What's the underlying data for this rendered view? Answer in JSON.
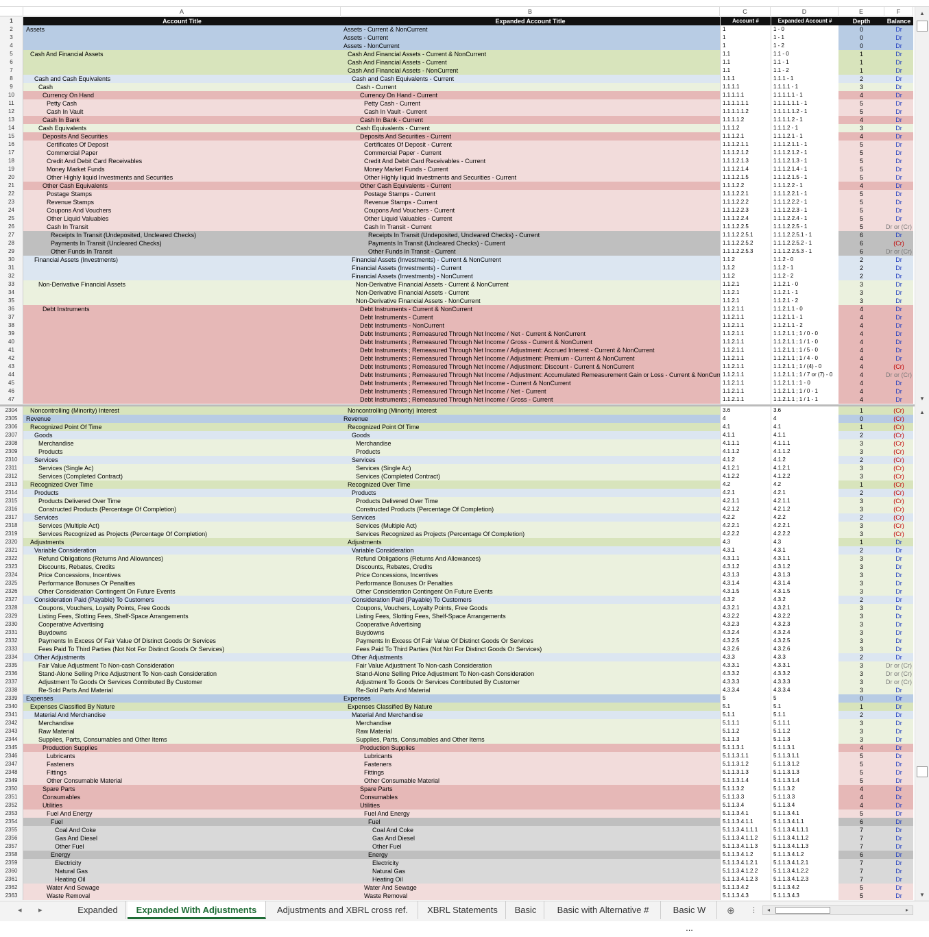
{
  "columns": [
    "A",
    "B",
    "C",
    "D",
    "E",
    "F"
  ],
  "header": {
    "row": "1",
    "a": "Account Title",
    "b": "Expanded Account Title",
    "c": "Account #",
    "d": "Expanded Account #",
    "e": "Depth",
    "f": "Balance"
  },
  "rows_top": [
    [
      "2",
      "Assets",
      "Assets - Current & NonCurrent",
      "1",
      "1 - 0",
      "0",
      "Dr",
      0
    ],
    [
      "3",
      "",
      "Assets - Current",
      "1",
      "1 - 1",
      "0",
      "Dr",
      0
    ],
    [
      "4",
      "",
      "Assets - NonCurrent",
      "1",
      "1 - 2",
      "0",
      "Dr",
      0
    ],
    [
      "5",
      "Cash And Financial Assets",
      "Cash And Financial Assets - Current & NonCurrent",
      "1.1",
      "1.1 - 0",
      "1",
      "Dr",
      1
    ],
    [
      "6",
      "",
      "Cash And Financial Assets - Current",
      "1.1",
      "1.1 - 1",
      "1",
      "Dr",
      1
    ],
    [
      "7",
      "",
      "Cash And Financial Assets - NonCurrent",
      "1.1",
      "1.1 - 2",
      "1",
      "Dr",
      1
    ],
    [
      "8",
      "Cash and Cash Equivalents",
      "Cash and Cash Equivalents - Current",
      "1.1.1",
      "1.1.1 - 1",
      "2",
      "Dr",
      2
    ],
    [
      "9",
      "Cash",
      "Cash - Current",
      "1.1.1.1",
      "1.1.1.1 - 1",
      "3",
      "Dr",
      3
    ],
    [
      "10",
      "Currency On Hand",
      "Currency On Hand - Current",
      "1.1.1.1.1",
      "1.1.1.1.1 - 1",
      "4",
      "Dr",
      4
    ],
    [
      "11",
      "Petty Cash",
      "Petty Cash - Current",
      "1.1.1.1.1.1",
      "1.1.1.1.1.1 - 1",
      "5",
      "Dr",
      5
    ],
    [
      "12",
      "Cash In Vault",
      "Cash In Vault - Current",
      "1.1.1.1.1.2",
      "1.1.1.1.1.2 - 1",
      "5",
      "Dr",
      5
    ],
    [
      "13",
      "Cash In Bank",
      "Cash In Bank - Current",
      "1.1.1.1.2",
      "1.1.1.1.2 - 1",
      "4",
      "Dr",
      4
    ],
    [
      "14",
      "Cash Equivalents",
      "Cash Equivalents - Current",
      "1.1.1.2",
      "1.1.1.2 - 1",
      "3",
      "Dr",
      3
    ],
    [
      "15",
      "Deposits And Securities",
      "Deposits And Securities - Current",
      "1.1.1.2.1",
      "1.1.1.2.1 - 1",
      "4",
      "Dr",
      4
    ],
    [
      "16",
      "Certificates Of Deposit",
      "Certificates Of Deposit - Current",
      "1.1.1.2.1.1",
      "1.1.1.2.1.1 - 1",
      "5",
      "Dr",
      5
    ],
    [
      "17",
      "Commercial Paper",
      "Commercial Paper - Current",
      "1.1.1.2.1.2",
      "1.1.1.2.1.2 - 1",
      "5",
      "Dr",
      5
    ],
    [
      "18",
      "Credit And Debit Card Receivables",
      "Credit And Debit Card Receivables - Current",
      "1.1.1.2.1.3",
      "1.1.1.2.1.3 - 1",
      "5",
      "Dr",
      5
    ],
    [
      "19",
      "Money Market Funds",
      "Money Market Funds - Current",
      "1.1.1.2.1.4",
      "1.1.1.2.1.4 - 1",
      "5",
      "Dr",
      5
    ],
    [
      "20",
      "Other Highly liquid Investments and Securities",
      "Other Highly liquid Investments and Securities - Current",
      "1.1.1.2.1.5",
      "1.1.1.2.1.5 - 1",
      "5",
      "Dr",
      5
    ],
    [
      "21",
      "Other Cash Equivalents",
      "Other Cash Equivalents - Current",
      "1.1.1.2.2",
      "1.1.1.2.2 - 1",
      "4",
      "Dr",
      4
    ],
    [
      "22",
      "Postage Stamps",
      "Postage Stamps - Current",
      "1.1.1.2.2.1",
      "1.1.1.2.2.1 - 1",
      "5",
      "Dr",
      5
    ],
    [
      "23",
      "Revenue Stamps",
      "Revenue Stamps - Current",
      "1.1.1.2.2.2",
      "1.1.1.2.2.2 - 1",
      "5",
      "Dr",
      5
    ],
    [
      "24",
      "Coupons And Vouchers",
      "Coupons And Vouchers - Current",
      "1.1.1.2.2.3",
      "1.1.1.2.2.3 - 1",
      "5",
      "Dr",
      5
    ],
    [
      "25",
      "Other Liquid Valuables",
      "Other Liquid Valuables - Current",
      "1.1.1.2.2.4",
      "1.1.1.2.2.4 - 1",
      "5",
      "Dr",
      5
    ],
    [
      "26",
      "Cash In Transit",
      "Cash In Transit - Current",
      "1.1.1.2.2.5",
      "1.1.1.2.2.5 - 1",
      "5",
      "Dr or (Cr)",
      5
    ],
    [
      "27",
      "Receipts In Transit (Undeposited, Uncleared Checks)",
      "Receipts In Transit (Undeposited, Uncleared Checks) - Current",
      "1.1.1.2.2.5.1",
      "1.1.1.2.2.5.1 - 1",
      "6",
      "Dr",
      6
    ],
    [
      "28",
      "Payments In Transit (Uncleared Checks)",
      "Payments In Transit (Uncleared Checks) - Current",
      "1.1.1.2.2.5.2",
      "1.1.1.2.2.5.2 - 1",
      "6",
      "(Cr)",
      6
    ],
    [
      "29",
      "Other Funds In Transit",
      "Other Funds In Transit - Current",
      "1.1.1.2.2.5.3",
      "1.1.1.2.2.5.3 - 1",
      "6",
      "Dr or (Cr)",
      6
    ],
    [
      "30",
      "Financial Assets (Investments)",
      "Financial Assets (Investments) - Current & NonCurrent",
      "1.1.2",
      "1.1.2 - 0",
      "2",
      "Dr",
      2
    ],
    [
      "31",
      "",
      "Financial Assets (Investments) - Current",
      "1.1.2",
      "1.1.2 - 1",
      "2",
      "Dr",
      2
    ],
    [
      "32",
      "",
      "Financial Assets (Investments) - NonCurrent",
      "1.1.2",
      "1.1.2 - 2",
      "2",
      "Dr",
      2
    ],
    [
      "33",
      "Non-Derivative Financial Assets",
      "Non-Derivative Financial Assets - Current & NonCurrent",
      "1.1.2.1",
      "1.1.2.1 - 0",
      "3",
      "Dr",
      3
    ],
    [
      "34",
      "",
      "Non-Derivative Financial Assets - Current",
      "1.1.2.1",
      "1.1.2.1 - 1",
      "3",
      "Dr",
      3
    ],
    [
      "35",
      "",
      "Non-Derivative Financial Assets - NonCurrent",
      "1.1.2.1",
      "1.1.2.1 - 2",
      "3",
      "Dr",
      3
    ],
    [
      "36",
      "Debt Instruments",
      "Debt Instruments - Current & NonCurrent",
      "1.1.2.1.1",
      "1.1.2.1.1 - 0",
      "4",
      "Dr",
      4
    ],
    [
      "37",
      "",
      "Debt Instruments - Current",
      "1.1.2.1.1",
      "1.1.2.1.1 - 1",
      "4",
      "Dr",
      4
    ],
    [
      "38",
      "",
      "Debt Instruments - NonCurrent",
      "1.1.2.1.1",
      "1.1.2.1.1 - 2",
      "4",
      "Dr",
      4
    ],
    [
      "39",
      "",
      "Debt Instruments ; Remeasured Through Net Income / Net - Current & NonCurrent",
      "1.1.2.1.1",
      "1.1.2.1.1 ; 1 / 0 - 0",
      "4",
      "Dr",
      4
    ],
    [
      "40",
      "",
      "Debt Instruments ; Remeasured Through Net Income / Gross - Current & NonCurrent",
      "1.1.2.1.1",
      "1.1.2.1.1 ; 1 / 1 - 0",
      "4",
      "Dr",
      4
    ],
    [
      "41",
      "",
      "Debt Instruments ; Remeasured Through Net Income / Adjustment: Accrued Interest - Current & NonCurrent",
      "1.1.2.1.1",
      "1.1.2.1.1 ; 1 / 5 - 0",
      "4",
      "Dr",
      4
    ],
    [
      "42",
      "",
      "Debt Instruments ; Remeasured Through Net Income / Adjustment: Premium - Current & NonCurrent",
      "1.1.2.1.1",
      "1.1.2.1.1 ; 1 / 4 - 0",
      "4",
      "Dr",
      4
    ],
    [
      "43",
      "",
      "Debt Instruments ; Remeasured Through Net Income / Adjustment: Discount - Current & NonCurrent",
      "1.1.2.1.1",
      "1.1.2.1.1 ; 1 / (4) - 0",
      "4",
      "(Cr)",
      4
    ],
    [
      "44",
      "",
      "Debt Instruments ; Remeasured Through Net Income / Adjustment: Accumulated Remeasurement Gain or Loss - Current & NonCurrent",
      "1.1.2.1.1",
      "1.1.2.1.1 ; 1 / 7 or (7) - 0",
      "4",
      "Dr or (Cr)",
      4
    ],
    [
      "45",
      "",
      "Debt Instruments ; Remeasured Through Net Income - Current & NonCurrent",
      "1.1.2.1.1",
      "1.1.2.1.1 ; 1 - 0",
      "4",
      "Dr",
      4
    ],
    [
      "46",
      "",
      "Debt Instruments ; Remeasured Through Net Income / Net - Current",
      "1.1.2.1.1",
      "1.1.2.1.1 ; 1 / 0 - 1",
      "4",
      "Dr",
      4
    ],
    [
      "47",
      "",
      "Debt Instruments ; Remeasured Through Net Income / Gross - Current",
      "1.1.2.1.1",
      "1.1.2.1.1 ; 1 / 1 - 1",
      "4",
      "Dr",
      4
    ]
  ],
  "rows_bottom": [
    [
      "2304",
      "Noncontrolling (Minority) Interest",
      "Noncontrolling (Minority) Interest",
      "3.6",
      "3.6",
      "1",
      "(Cr)",
      1
    ],
    [
      "2305",
      "Revenue",
      "Revenue",
      "4",
      "4",
      "0",
      "(Cr)",
      0
    ],
    [
      "2306",
      "Recognized Point Of Time",
      "Recognized Point Of Time",
      "4.1",
      "4.1",
      "1",
      "(Cr)",
      1
    ],
    [
      "2307",
      "Goods",
      "Goods",
      "4.1.1",
      "4.1.1",
      "2",
      "(Cr)",
      2
    ],
    [
      "2308",
      "Merchandise",
      "Merchandise",
      "4.1.1.1",
      "4.1.1.1",
      "3",
      "(Cr)",
      3
    ],
    [
      "2309",
      "Products",
      "Products",
      "4.1.1.2",
      "4.1.1.2",
      "3",
      "(Cr)",
      3
    ],
    [
      "2310",
      "Services",
      "Services",
      "4.1.2",
      "4.1.2",
      "2",
      "(Cr)",
      2
    ],
    [
      "2311",
      "Services (Single Ac)",
      "Services (Single Ac)",
      "4.1.2.1",
      "4.1.2.1",
      "3",
      "(Cr)",
      3
    ],
    [
      "2312",
      "Services (Completed Contract)",
      "Services (Completed Contract)",
      "4.1.2.2",
      "4.1.2.2",
      "3",
      "(Cr)",
      3
    ],
    [
      "2313",
      "Recognized Over Time",
      "Recognized Over Time",
      "4.2",
      "4.2",
      "1",
      "(Cr)",
      1
    ],
    [
      "2314",
      "Products",
      "Products",
      "4.2.1",
      "4.2.1",
      "2",
      "(Cr)",
      2
    ],
    [
      "2315",
      "Products Delivered Over Time",
      "Products Delivered Over Time",
      "4.2.1.1",
      "4.2.1.1",
      "3",
      "(Cr)",
      3
    ],
    [
      "2316",
      "Constructed Products (Percentage Of Completion)",
      "Constructed Products (Percentage Of Completion)",
      "4.2.1.2",
      "4.2.1.2",
      "3",
      "(Cr)",
      3
    ],
    [
      "2317",
      "Services",
      "Services",
      "4.2.2",
      "4.2.2",
      "2",
      "(Cr)",
      2
    ],
    [
      "2318",
      "Services (Multiple Act)",
      "Services (Multiple Act)",
      "4.2.2.1",
      "4.2.2.1",
      "3",
      "(Cr)",
      3
    ],
    [
      "2319",
      "Services Recognized as Projects (Percentage Of Completion)",
      "Services Recognized as Projects (Percentage Of Completion)",
      "4.2.2.2",
      "4.2.2.2",
      "3",
      "(Cr)",
      3
    ],
    [
      "2320",
      "Adjustments",
      "Adjustments",
      "4.3",
      "4.3",
      "1",
      "Dr",
      1
    ],
    [
      "2321",
      "Variable Consideration",
      "Variable Consideration",
      "4.3.1",
      "4.3.1",
      "2",
      "Dr",
      2
    ],
    [
      "2322",
      "Refund Obligations (Returns And Allowances)",
      "Refund Obligations (Returns And Allowances)",
      "4.3.1.1",
      "4.3.1.1",
      "3",
      "Dr",
      3
    ],
    [
      "2323",
      "Discounts, Rebates, Credits",
      "Discounts, Rebates, Credits",
      "4.3.1.2",
      "4.3.1.2",
      "3",
      "Dr",
      3
    ],
    [
      "2324",
      "Price Concessions, Incentives",
      "Price Concessions, Incentives",
      "4.3.1.3",
      "4.3.1.3",
      "3",
      "Dr",
      3
    ],
    [
      "2325",
      "Performance Bonuses Or Penalties",
      "Performance Bonuses Or Penalties",
      "4.3.1.4",
      "4.3.1.4",
      "3",
      "Dr",
      3
    ],
    [
      "2326",
      "Other Consideration Contingent On Future Events",
      "Other Consideration Contingent On Future Events",
      "4.3.1.5",
      "4.3.1.5",
      "3",
      "Dr",
      3
    ],
    [
      "2327",
      "Consideration Paid (Payable) To Customers",
      "Consideration Paid (Payable) To Customers",
      "4.3.2",
      "4.3.2",
      "2",
      "Dr",
      2
    ],
    [
      "2328",
      "Coupons, Vouchers, Loyalty Points, Free Goods",
      "Coupons, Vouchers, Loyalty Points, Free Goods",
      "4.3.2.1",
      "4.3.2.1",
      "3",
      "Dr",
      3
    ],
    [
      "2329",
      "Listing Fees, Slotting Fees, Shelf-Space Arrangements",
      "Listing Fees, Slotting Fees, Shelf-Space Arrangements",
      "4.3.2.2",
      "4.3.2.2",
      "3",
      "Dr",
      3
    ],
    [
      "2330",
      "Cooperative Advertising",
      "Cooperative Advertising",
      "4.3.2.3",
      "4.3.2.3",
      "3",
      "Dr",
      3
    ],
    [
      "2331",
      "Buydowns",
      "Buydowns",
      "4.3.2.4",
      "4.3.2.4",
      "3",
      "Dr",
      3
    ],
    [
      "2332",
      "Payments In Excess Of Fair Value Of Distinct Goods Or Services",
      "Payments In Excess Of Fair Value Of Distinct Goods Or Services",
      "4.3.2.5",
      "4.3.2.5",
      "3",
      "Dr",
      3
    ],
    [
      "2333",
      "Fees Paid To Third Parties (Not Not For Distinct Goods Or Services)",
      "Fees Paid To Third Parties (Not Not For Distinct Goods Or Services)",
      "4.3.2.6",
      "4.3.2.6",
      "3",
      "Dr",
      3
    ],
    [
      "2334",
      "Other Adjustments",
      "Other Adjustments",
      "4.3.3",
      "4.3.3",
      "2",
      "Dr",
      2
    ],
    [
      "2335",
      "Fair Value Adjustment To Non-cash Consideration",
      "Fair Value Adjustment To Non-cash Consideration",
      "4.3.3.1",
      "4.3.3.1",
      "3",
      "Dr or (Cr)",
      3
    ],
    [
      "2336",
      "Stand-Alone Selling Price Adjustment To Non-cash Consideration",
      "Stand-Alone Selling Price Adjustment To Non-cash Consideration",
      "4.3.3.2",
      "4.3.3.2",
      "3",
      "Dr or (Cr)",
      3
    ],
    [
      "2337",
      "Adjustment To Goods Or Services Contributed By Customer",
      "Adjustment To Goods Or Services Contributed By Customer",
      "4.3.3.3",
      "4.3.3.3",
      "3",
      "Dr or (Cr)",
      3
    ],
    [
      "2338",
      "Re-Sold Parts And Material",
      "Re-Sold Parts And Material",
      "4.3.3.4",
      "4.3.3.4",
      "3",
      "Dr",
      3
    ],
    [
      "2339",
      "Expenses",
      "Expenses",
      "5",
      "5",
      "0",
      "Dr",
      0
    ],
    [
      "2340",
      "Expenses Classified By Nature",
      "Expenses Classified By Nature",
      "5.1",
      "5.1",
      "1",
      "Dr",
      1
    ],
    [
      "2341",
      "Material And Merchandise",
      "Material And Merchandise",
      "5.1.1",
      "5.1.1",
      "2",
      "Dr",
      2
    ],
    [
      "2342",
      "Merchandise",
      "Merchandise",
      "5.1.1.1",
      "5.1.1.1",
      "3",
      "Dr",
      3
    ],
    [
      "2343",
      "Raw Material",
      "Raw Material",
      "5.1.1.2",
      "5.1.1.2",
      "3",
      "Dr",
      3
    ],
    [
      "2344",
      "Supplies, Parts, Consumables and Other Items",
      "Supplies, Parts, Consumables and Other Items",
      "5.1.1.3",
      "5.1.1.3",
      "3",
      "Dr",
      3
    ],
    [
      "2345",
      "Production Supplies",
      "Production Supplies",
      "5.1.1.3.1",
      "5.1.1.3.1",
      "4",
      "Dr",
      4
    ],
    [
      "2346",
      "Lubricants",
      "Lubricants",
      "5.1.1.3.1.1",
      "5.1.1.3.1.1",
      "5",
      "Dr",
      5
    ],
    [
      "2347",
      "Fasteners",
      "Fasteners",
      "5.1.1.3.1.2",
      "5.1.1.3.1.2",
      "5",
      "Dr",
      5
    ],
    [
      "2348",
      "Fittings",
      "Fittings",
      "5.1.1.3.1.3",
      "5.1.1.3.1.3",
      "5",
      "Dr",
      5
    ],
    [
      "2349",
      "Other Consumable Material",
      "Other Consumable Material",
      "5.1.1.3.1.4",
      "5.1.1.3.1.4",
      "5",
      "Dr",
      5
    ],
    [
      "2350",
      "Spare Parts",
      "Spare Parts",
      "5.1.1.3.2",
      "5.1.1.3.2",
      "4",
      "Dr",
      4
    ],
    [
      "2351",
      "Consumables",
      "Consumables",
      "5.1.1.3.3",
      "5.1.1.3.3",
      "4",
      "Dr",
      4
    ],
    [
      "2352",
      "Utilities",
      "Utilities",
      "5.1.1.3.4",
      "5.1.1.3.4",
      "4",
      "Dr",
      4
    ],
    [
      "2353",
      "Fuel And Energy",
      "Fuel And Energy",
      "5.1.1.3.4.1",
      "5.1.1.3.4.1",
      "5",
      "Dr",
      5
    ],
    [
      "2354",
      "Fuel",
      "Fuel",
      "5.1.1.3.4.1.1",
      "5.1.1.3.4.1.1",
      "6",
      "Dr",
      6
    ],
    [
      "2355",
      "Coal And Coke",
      "Coal And Coke",
      "5.1.1.3.4.1.1.1",
      "5.1.1.3.4.1.1.1",
      "7",
      "Dr",
      7
    ],
    [
      "2356",
      "Gas And Diesel",
      "Gas And Diesel",
      "5.1.1.3.4.1.1.2",
      "5.1.1.3.4.1.1.2",
      "7",
      "Dr",
      7
    ],
    [
      "2357",
      "Other Fuel",
      "Other Fuel",
      "5.1.1.3.4.1.1.3",
      "5.1.1.3.4.1.1.3",
      "7",
      "Dr",
      7
    ],
    [
      "2358",
      "Energy",
      "Energy",
      "5.1.1.3.4.1.2",
      "5.1.1.3.4.1.2",
      "6",
      "Dr",
      6
    ],
    [
      "2359",
      "Electricity",
      "Electricity",
      "5.1.1.3.4.1.2.1",
      "5.1.1.3.4.1.2.1",
      "7",
      "Dr",
      7
    ],
    [
      "2360",
      "Natural Gas",
      "Natural Gas",
      "5.1.1.3.4.1.2.2",
      "5.1.1.3.4.1.2.2",
      "7",
      "Dr",
      7
    ],
    [
      "2361",
      "Heating Oil",
      "Heating Oil",
      "5.1.1.3.4.1.2.3",
      "5.1.1.3.4.1.2.3",
      "7",
      "Dr",
      7
    ],
    [
      "2362",
      "Water And Sewage",
      "Water And Sewage",
      "5.1.1.3.4.2",
      "5.1.1.3.4.2",
      "5",
      "Dr",
      5
    ],
    [
      "2363",
      "Waste Removal",
      "Waste Removal",
      "5.1.1.3.4.3",
      "5.1.1.3.4.3",
      "5",
      "Dr",
      5
    ]
  ],
  "tabs": [
    "Expanded",
    "Expanded With Adjustments",
    "Adjustments and XBRL cross ref.",
    "XBRL Statements",
    "Basic",
    "Basic with Alternative #",
    "Basic W ..."
  ],
  "active_tab": "Expanded With Adjustments",
  "nav": {
    "prev": "◂",
    "next": "▸",
    "add": "⊕",
    "more": "⋮"
  },
  "scroll": {
    "up": "▲",
    "down": "▼",
    "left": "◂",
    "right": "▸"
  }
}
